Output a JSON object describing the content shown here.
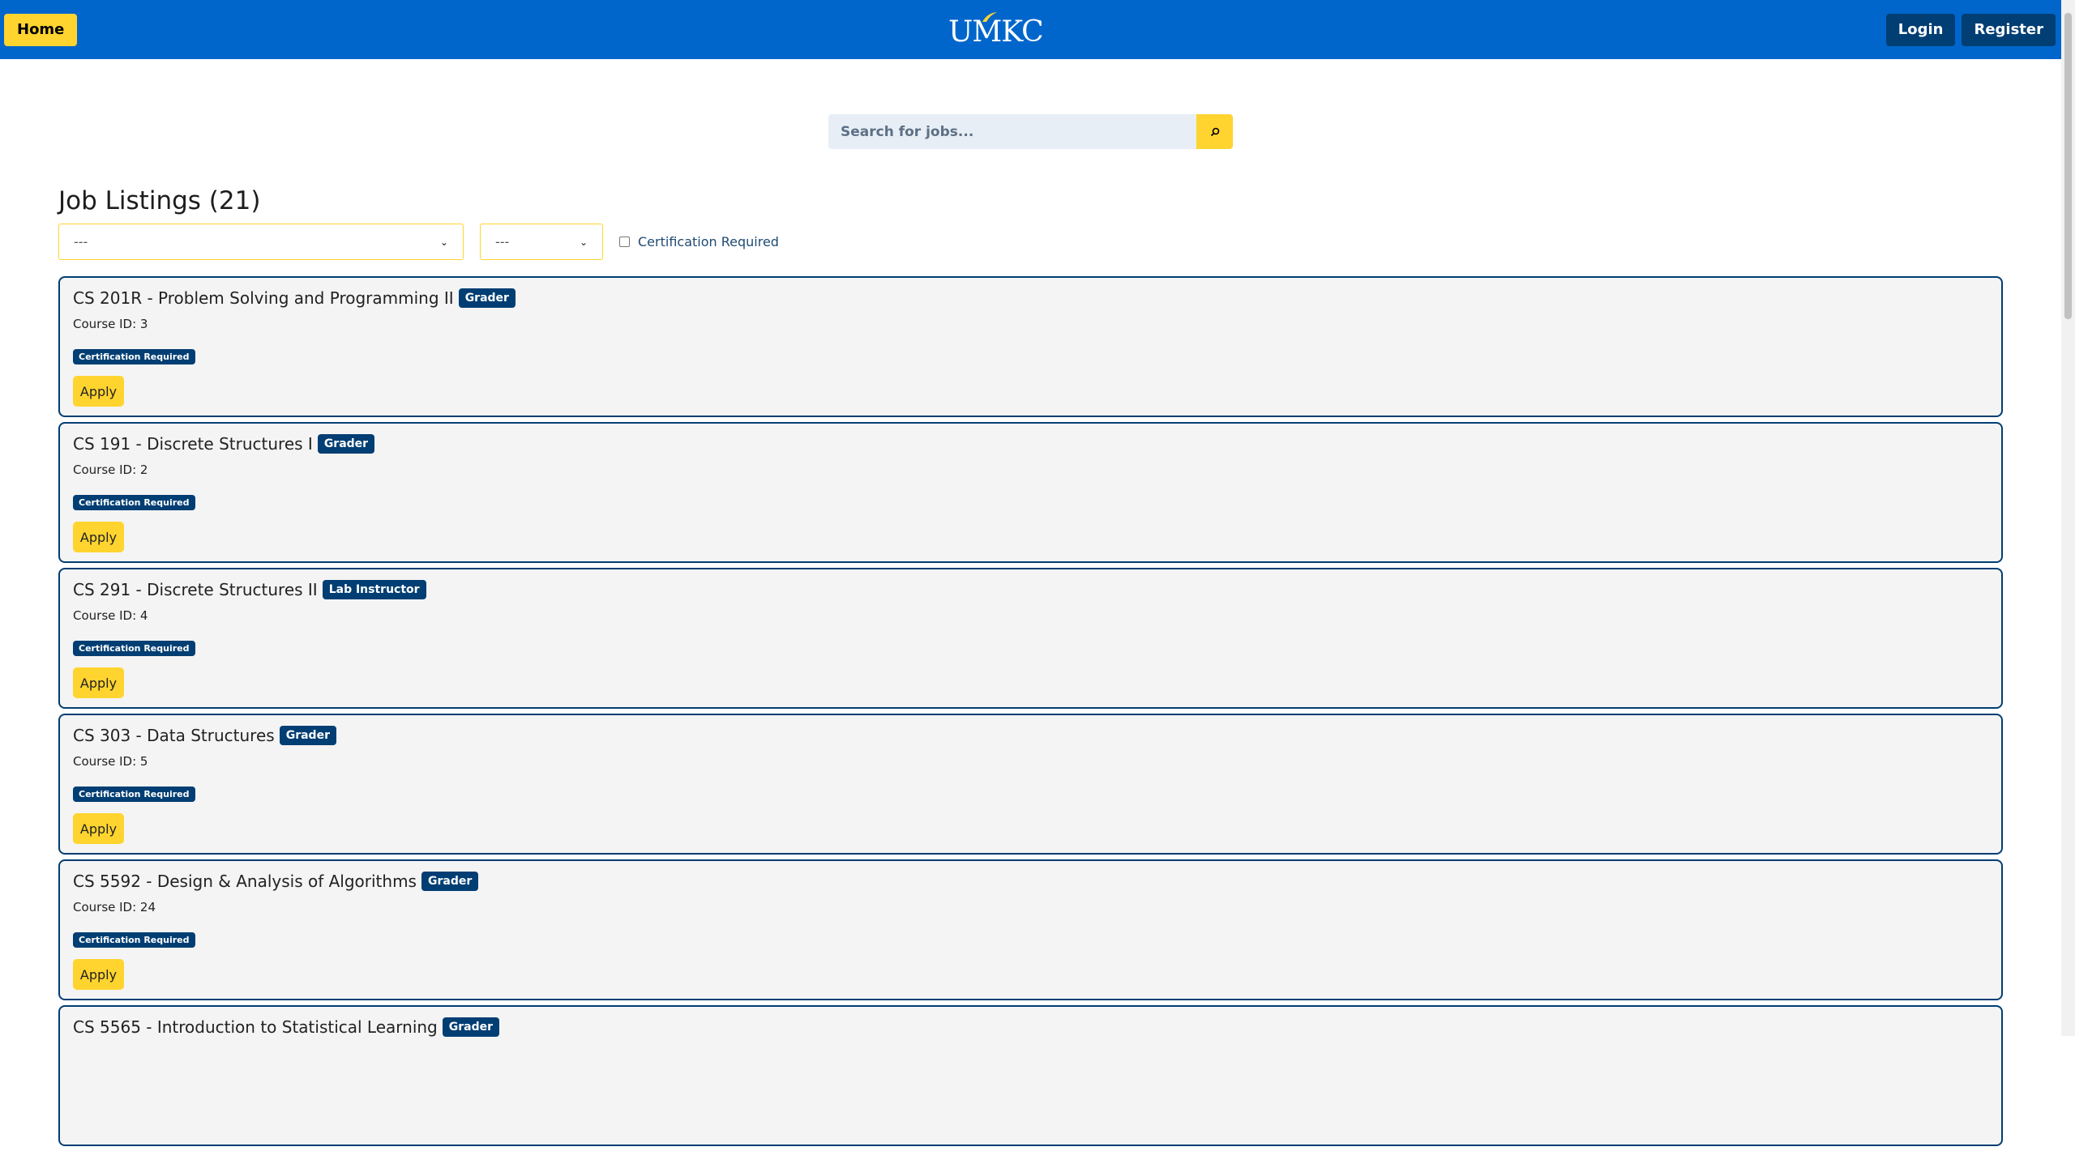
{
  "nav": {
    "home_label": "Home",
    "logo_text": "UMKC",
    "login_label": "Login",
    "register_label": "Register"
  },
  "search": {
    "placeholder": "Search for jobs...",
    "icon": "search-icon"
  },
  "listings_header": {
    "title": "Job Listings (21)"
  },
  "filters": {
    "select1_value": "---",
    "select2_value": "---",
    "cert_label": "Certification Required",
    "cert_checked": false
  },
  "jobs": [
    {
      "title": "CS 201R - Problem Solving and Programming II",
      "role": "Grader",
      "course_id": "Course ID: 3",
      "cert": "Certification Required",
      "apply": "Apply"
    },
    {
      "title": "CS 191 - Discrete Structures I",
      "role": "Grader",
      "course_id": "Course ID: 2",
      "cert": "Certification Required",
      "apply": "Apply"
    },
    {
      "title": "CS 291 - Discrete Structures II",
      "role": "Lab Instructor",
      "course_id": "Course ID: 4",
      "cert": "Certification Required",
      "apply": "Apply"
    },
    {
      "title": "CS 303 - Data Structures",
      "role": "Grader",
      "course_id": "Course ID: 5",
      "cert": "Certification Required",
      "apply": "Apply"
    },
    {
      "title": "CS 5592 - Design & Analysis of Algorithms",
      "role": "Grader",
      "course_id": "Course ID: 24",
      "cert": "Certification Required",
      "apply": "Apply"
    },
    {
      "title": "CS 5565 - Introduction to Statistical Learning",
      "role": "Grader",
      "course_id": "",
      "cert": "",
      "apply": ""
    }
  ],
  "colors": {
    "brand_blue": "#0066cc",
    "navy": "#003e73",
    "gold": "#ffd42f"
  }
}
